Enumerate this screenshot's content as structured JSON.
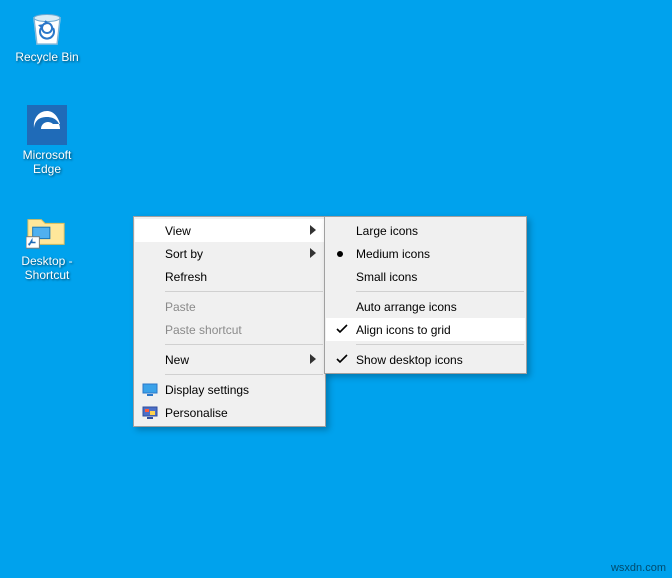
{
  "desktop": {
    "icons": [
      {
        "id": "recycle-bin",
        "label": "Recycle Bin"
      },
      {
        "id": "edge",
        "label": "Microsoft Edge"
      },
      {
        "id": "desktop-sc",
        "label": "Desktop - Shortcut"
      }
    ]
  },
  "menu": {
    "items": [
      {
        "id": "view",
        "label": "View",
        "submenu": true,
        "hover": true
      },
      {
        "id": "sortby",
        "label": "Sort by",
        "submenu": true
      },
      {
        "id": "refresh",
        "label": "Refresh"
      },
      {
        "sep": true
      },
      {
        "id": "paste",
        "label": "Paste",
        "disabled": true
      },
      {
        "id": "pasteshortcut",
        "label": "Paste shortcut",
        "disabled": true
      },
      {
        "sep": true
      },
      {
        "id": "new",
        "label": "New",
        "submenu": true
      },
      {
        "sep": true
      },
      {
        "id": "display",
        "label": "Display settings",
        "icon": "display"
      },
      {
        "id": "personal",
        "label": "Personalise",
        "icon": "personalise"
      }
    ]
  },
  "submenu": {
    "items": [
      {
        "id": "large",
        "label": "Large icons"
      },
      {
        "id": "medium",
        "label": "Medium icons",
        "bullet": true
      },
      {
        "id": "small",
        "label": "Small icons"
      },
      {
        "sep": true
      },
      {
        "id": "autoarr",
        "label": "Auto arrange icons"
      },
      {
        "id": "align",
        "label": "Align icons to grid",
        "check": true,
        "hover": true
      },
      {
        "sep": true
      },
      {
        "id": "showdi",
        "label": "Show desktop icons",
        "check": true
      }
    ]
  },
  "watermark": "wsxdn.com",
  "colors": {
    "desktop_bg": "#00a2ed",
    "menu_bg": "#f0f0f0",
    "menu_hover": "#ffffff",
    "disabled": "#8a8a8a"
  }
}
